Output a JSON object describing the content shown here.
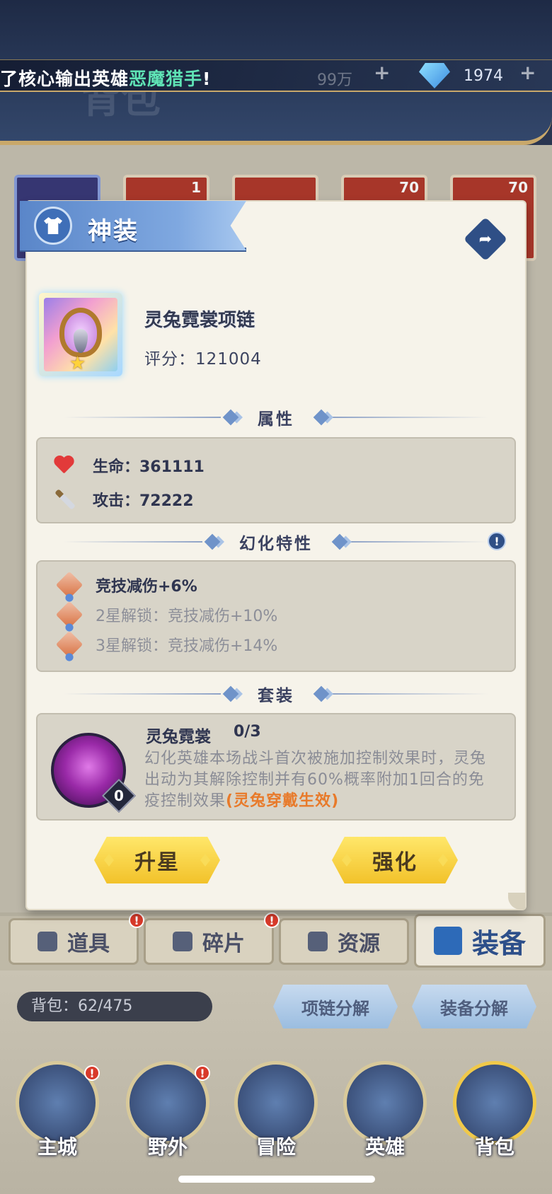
{
  "ticker": {
    "prefix": "了核心输出英雄",
    "highlight": "恶魔猎手",
    "suffix": "!"
  },
  "header": {
    "bg_title": "背包",
    "gold_value": "99万",
    "gem_value": "1974"
  },
  "grid": {
    "slot_counts": [
      "1",
      "70",
      "70"
    ]
  },
  "modal": {
    "title": "神装",
    "item": {
      "name": "灵兔霓裳项链",
      "score": "评分：121004"
    },
    "sections": {
      "attributes": "属性",
      "traits": "幻化特性",
      "set": "套装"
    },
    "stats": [
      {
        "label": "生命：361111",
        "icon": "heart-icon"
      },
      {
        "label": "攻击：72222",
        "icon": "sword-icon"
      }
    ],
    "traits": [
      {
        "text": "竞技减伤+6%",
        "active": true
      },
      {
        "text": "2星解锁：竞技减伤+10%",
        "active": false
      },
      {
        "text": "3星解锁：竞技减伤+14%",
        "active": false
      }
    ],
    "set": {
      "name": "灵兔霓裳",
      "progress": "0/3",
      "badge": "0",
      "description": "幻化英雄本场战斗首次被施加控制效果时，灵兔出动为其解除控制并有60%概率附加1回合的免疫控制效果",
      "highlight": "(灵兔穿戴生效)"
    },
    "buttons": {
      "upgrade_star": "升星",
      "strengthen": "强化"
    }
  },
  "tabs": [
    {
      "label": "道具",
      "badge": true
    },
    {
      "label": "碎片",
      "badge": true
    },
    {
      "label": "资源",
      "badge": false
    },
    {
      "label": "装备",
      "badge": false
    }
  ],
  "bag": {
    "count": "背包：62/475"
  },
  "decompose": {
    "necklace": "项链分解",
    "equipment": "装备分解"
  },
  "nav": [
    {
      "label": "主城",
      "badge": true
    },
    {
      "label": "野外",
      "badge": true
    },
    {
      "label": "冒险",
      "badge": false
    },
    {
      "label": "英雄",
      "badge": false
    },
    {
      "label": "背包",
      "badge": false
    }
  ],
  "colors": {
    "accent": "#2f4f86",
    "highlight_orange": "#e87a2a",
    "ticker_green": "#5fe3b5",
    "button_yellow": "#f2c22a"
  }
}
